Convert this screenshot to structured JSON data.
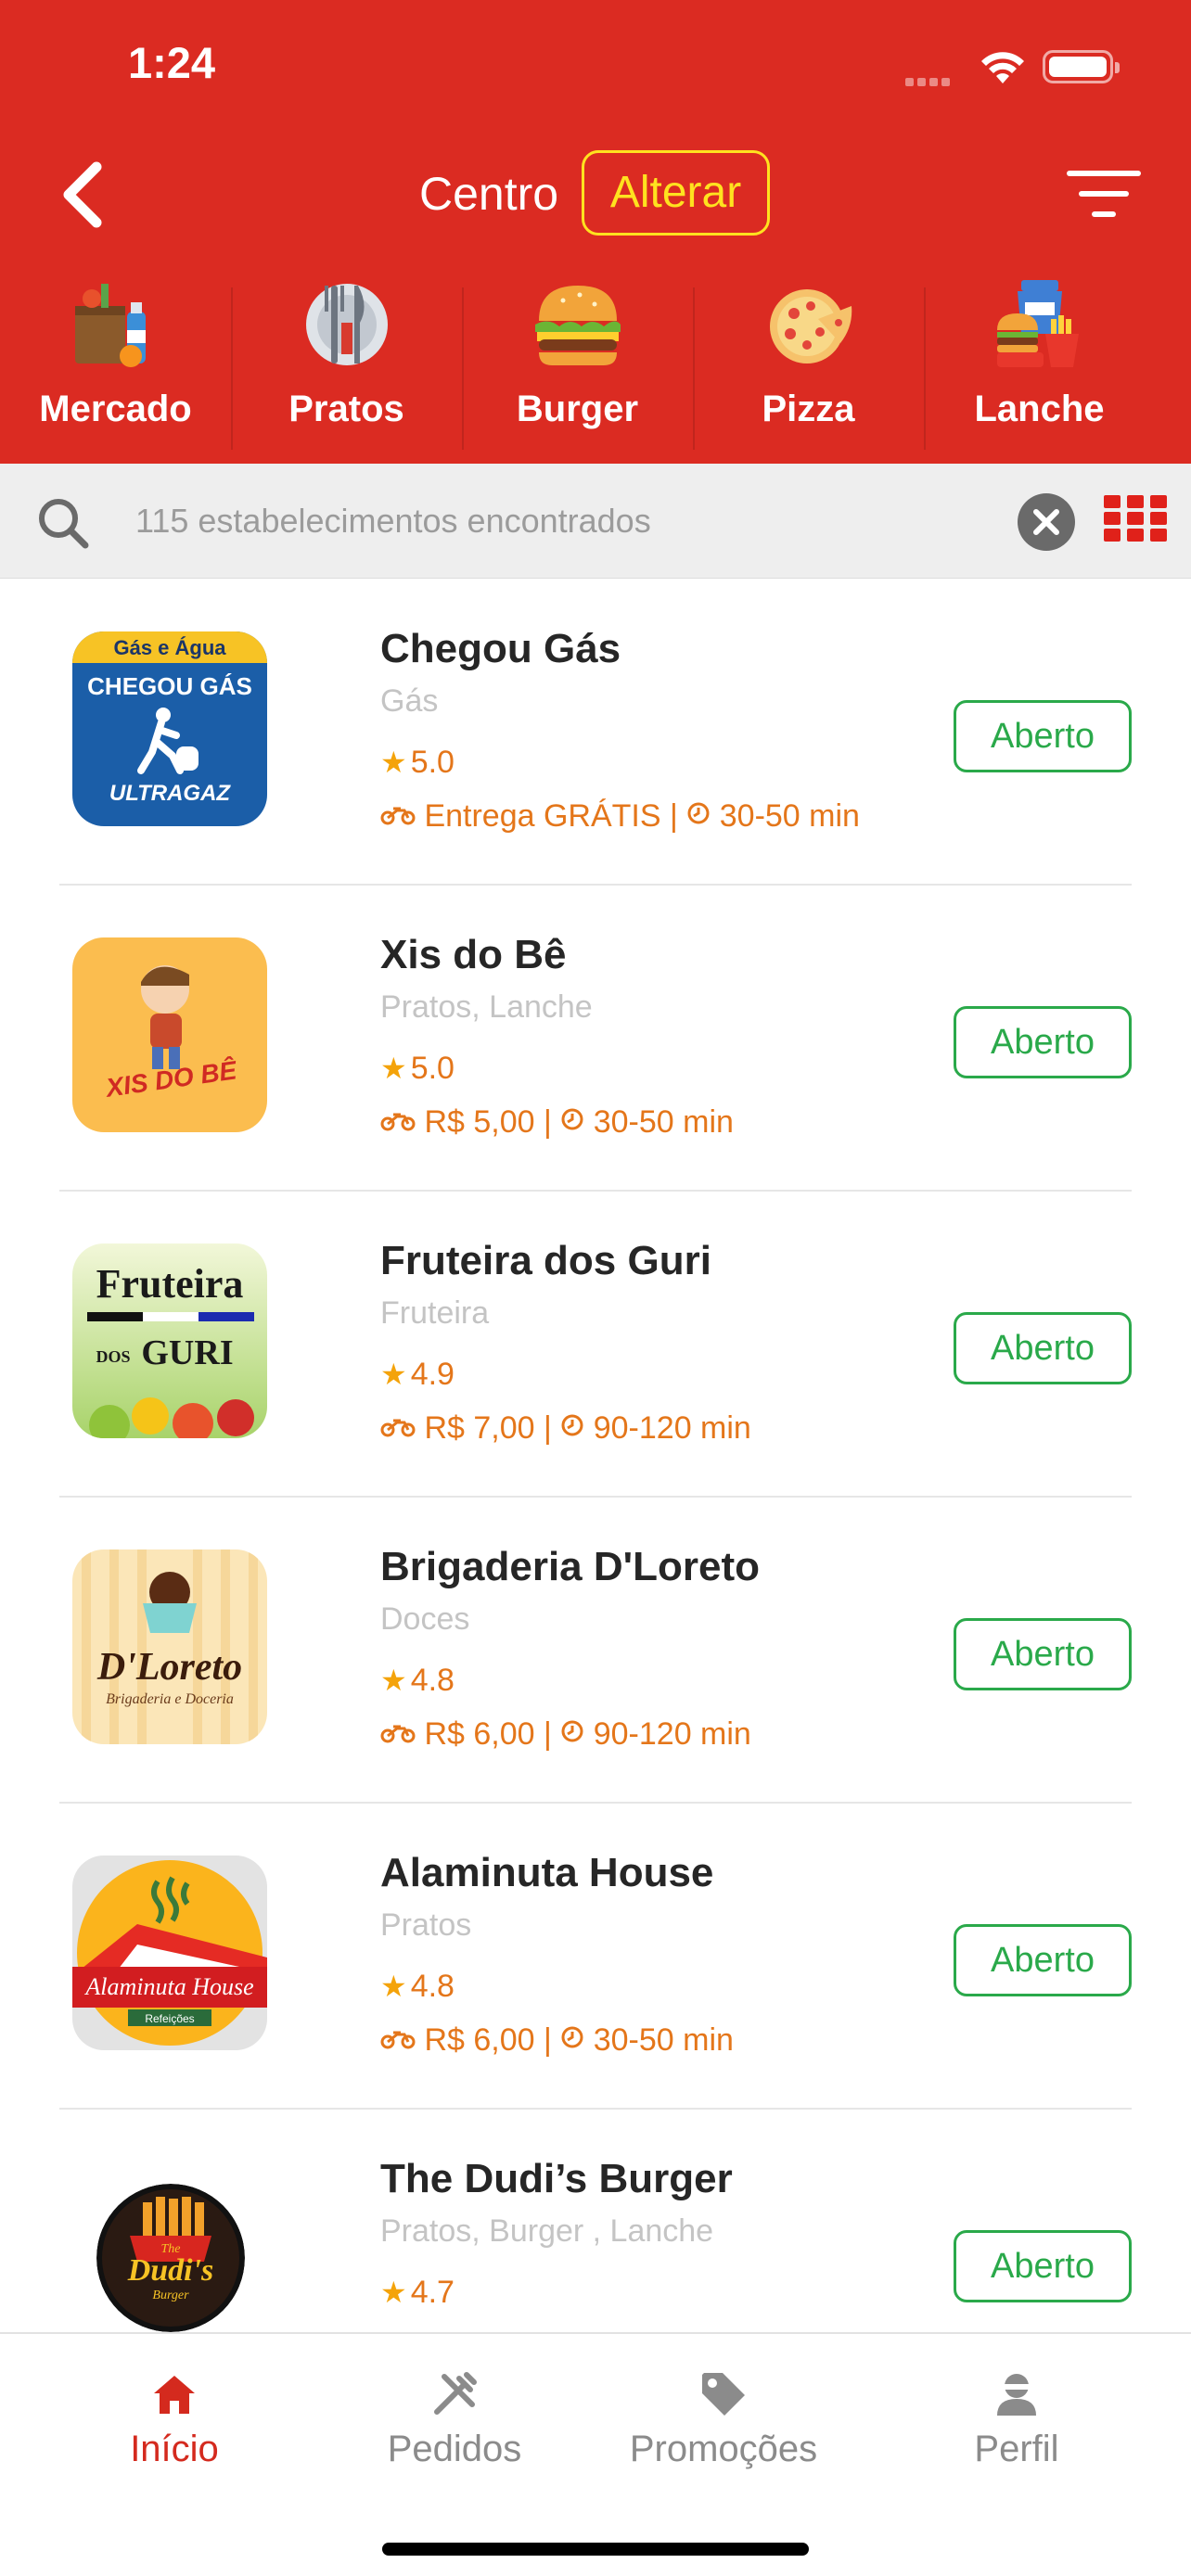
{
  "status_bar": {
    "time": "1:24"
  },
  "header": {
    "city": "Centro",
    "change_label": "Alterar"
  },
  "categories": [
    {
      "label": "Mercado",
      "icon": "grocery-bag-icon"
    },
    {
      "label": "Pratos",
      "icon": "plate-cutlery-icon"
    },
    {
      "label": "Burger",
      "icon": "burger-icon"
    },
    {
      "label": "Pizza",
      "icon": "pizza-icon"
    },
    {
      "label": "Lanche",
      "icon": "snack-combo-icon"
    }
  ],
  "search": {
    "placeholder": "115 estabelecimentos encontrados"
  },
  "stores": [
    {
      "name": "Chegou Gás",
      "category": "Gás",
      "rating": "5.0",
      "delivery": "Entrega GRÁTIS",
      "time": "30-50 min",
      "status": "Aberto",
      "logo": {
        "top_text": "Gás e Água",
        "main_text": "CHEGOU GÁS",
        "brand": "ULTRAGAZ"
      }
    },
    {
      "name": "Xis do Bê",
      "category": "Pratos, Lanche",
      "rating": "5.0",
      "delivery": "R$ 5,00",
      "time": "30-50 min",
      "status": "Aberto",
      "logo": {
        "main_text": "XIS DO BÊ"
      }
    },
    {
      "name": "Fruteira dos Guri",
      "category": "Fruteira",
      "rating": "4.9",
      "delivery": "R$ 7,00",
      "time": "90-120 min",
      "status": "Aberto",
      "logo": {
        "line1": "Fruteira",
        "line2": "DOS",
        "line3": "GURI"
      }
    },
    {
      "name": "Brigaderia D'Loreto",
      "category": "Doces",
      "rating": "4.8",
      "delivery": "R$ 6,00",
      "time": "90-120 min",
      "status": "Aberto",
      "logo": {
        "main_text": "D'Loreto",
        "sub_text": "Brigaderia e Doceria"
      }
    },
    {
      "name": "Alaminuta House",
      "category": "Pratos",
      "rating": "4.8",
      "delivery": "R$ 6,00",
      "time": "30-50 min",
      "status": "Aberto",
      "logo": {
        "main_text": "Alaminuta House",
        "sub_text": "Refeições"
      }
    },
    {
      "name": "The Dudi’s Burger",
      "category": "Pratos, Burger , Lanche",
      "rating": "4.7",
      "status": "Aberto",
      "logo": {
        "main_text": "Dudi's",
        "top_text": "The",
        "sub_text": "Burger"
      }
    }
  ],
  "tab_bar": {
    "tabs": [
      {
        "label": "Início",
        "icon": "home-icon",
        "active": true
      },
      {
        "label": "Pedidos",
        "icon": "cutlery-icon",
        "active": false
      },
      {
        "label": "Promoções",
        "icon": "tag-icon",
        "active": false
      },
      {
        "label": "Perfil",
        "icon": "user-icon",
        "active": false
      }
    ]
  },
  "colors": {
    "brand_red": "#db2b22",
    "highlight_yellow": "#ffe21f",
    "open_green": "#2aa94a",
    "accent_orange": "#e4761a"
  }
}
